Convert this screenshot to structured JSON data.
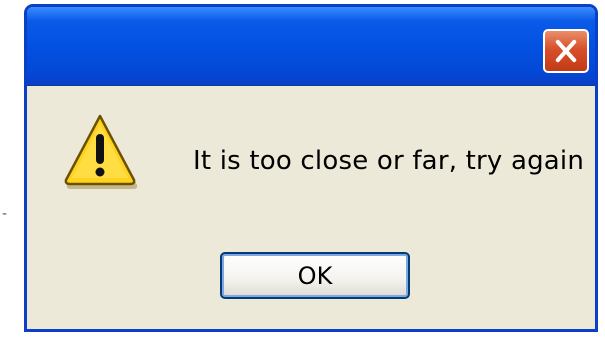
{
  "dialog": {
    "title": "",
    "message": "It is too close or far, try again",
    "ok_label": "OK"
  },
  "icons": {
    "close": "close-icon",
    "warning": "warning-icon"
  },
  "colors": {
    "titlebar": "#0350e0",
    "frame": "#0b3fc6",
    "body": "#ece9d8",
    "close_button": "#d7502b",
    "warning_fill": "#ffd21f"
  }
}
